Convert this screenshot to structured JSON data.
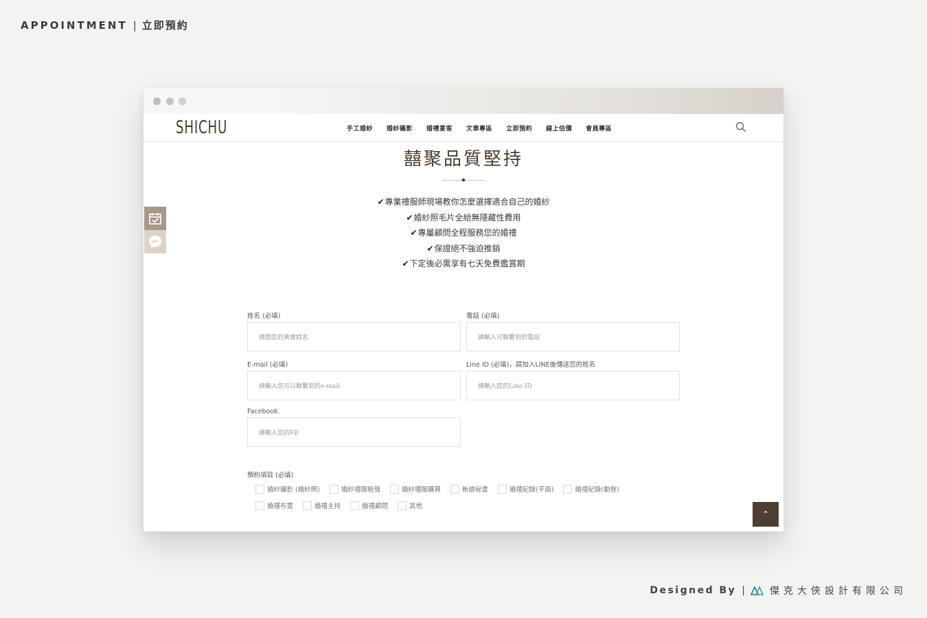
{
  "page": {
    "heading_en": "APPOINTMENT",
    "heading_sep": "|",
    "heading_zh": "立即預約"
  },
  "site": {
    "logo": "SHICHU",
    "nav": [
      "手工婚紗",
      "婚紗攝影",
      "婚禮宴客",
      "文章專區",
      "立即預約",
      "線上估價",
      "會員專區"
    ]
  },
  "main": {
    "title": "囍聚品質堅持",
    "check_mark": "✔",
    "features": [
      "專業禮服師現場教你怎麼選擇適合自己的婚紗",
      "婚紗照毛片全給無隱藏性費用",
      "專屬顧問全程服務您的婚禮",
      "保證絕不強迫推銷",
      "下定後必需享有七天免費鑑賞期"
    ]
  },
  "form": {
    "name": {
      "label": "姓名 (必填)",
      "placeholder": "請問您的真實姓名"
    },
    "phone": {
      "label": "電話 (必填)",
      "placeholder": "請輸入可聯繫到的電話"
    },
    "email": {
      "label": "E-mail (必填)",
      "placeholder": "請輸入您可以聯繫到的e-mail"
    },
    "line": {
      "label": "Line ID (必填)，請加入LINE後傳送您的姓名",
      "placeholder": "請輸入您的Line ID"
    },
    "facebook": {
      "label": "Facebook",
      "placeholder": "請輸入您的FB"
    },
    "items_label": "預約項目 (必填)",
    "items_row1": [
      "婚紗攝影 (婚紗照)",
      "婚紗禮服租借",
      "婚紗禮服購買",
      "新娘秘書",
      "婚禮紀錄(平面)",
      "婚禮紀錄(動態)"
    ],
    "items_row2": [
      "婚禮布置",
      "婚禮主持",
      "婚禮顧問",
      "其他"
    ]
  },
  "to_top": "⌃",
  "credit": {
    "designed_by": "Designed By",
    "sep": "|",
    "company": "傑克大俠設計有限公司"
  },
  "colors": {
    "brand_brown": "#4a3b2e",
    "side_calendar": "#a7988a",
    "side_messenger": "#ddd2c7",
    "to_top_bg": "#4e3f30",
    "credit_logo_blue": "#2b6f9e",
    "credit_logo_green": "#3aa58d"
  }
}
